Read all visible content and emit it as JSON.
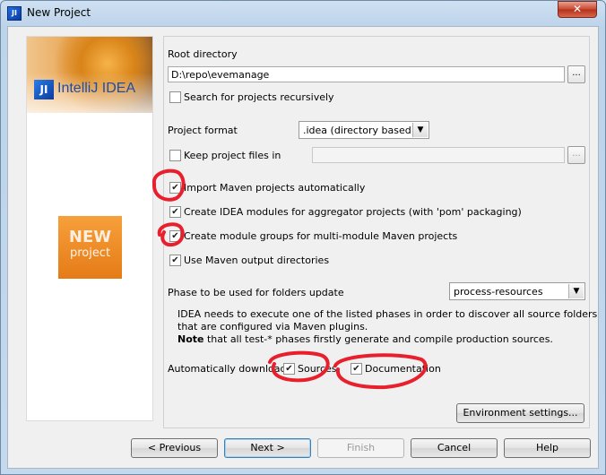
{
  "window": {
    "title": "New Project",
    "close_icon": "close-icon"
  },
  "banner": {
    "logo_text": "IntelliJ IDEA",
    "new_label": "NEW",
    "project_label": "project"
  },
  "form": {
    "root_dir_label": "Root directory",
    "root_dir_value": "D:\\repo\\evemanage",
    "browse_label": "...",
    "search_recursive_label": "Search for projects recursively",
    "search_recursive_checked": false,
    "project_format_label": "Project format",
    "project_format_value": ".idea (directory based)",
    "keep_files_label": "Keep project files in",
    "keep_files_checked": false,
    "keep_files_value": "",
    "keep_files_browse": "...",
    "import_maven_label": "Import Maven projects automatically",
    "import_maven_checked": true,
    "create_modules_label": "Create IDEA modules for aggregator projects (with 'pom' packaging)",
    "create_modules_checked": true,
    "create_groups_label": "Create module groups for multi-module Maven projects",
    "create_groups_checked": true,
    "use_output_label": "Use Maven output directories",
    "use_output_checked": true,
    "phase_label": "Phase to be used for folders update",
    "phase_value": "process-resources",
    "info_line1": "IDEA needs to execute one of the listed phases in order to discover all source folders",
    "info_line2": "that are configured via Maven plugins.",
    "info_note_bold": "Note",
    "info_note_rest": " that all test-* phases firstly generate and compile production sources.",
    "auto_download_label": "Automatically download",
    "sources_label": "Sources",
    "sources_checked": true,
    "docs_label": "Documentation",
    "docs_checked": true,
    "env_settings_label": "Environment settings..."
  },
  "buttons": {
    "previous": "< Previous",
    "next": "Next >",
    "finish": "Finish",
    "cancel": "Cancel",
    "help": "Help"
  },
  "colors": {
    "annotation_red": "#e8202e",
    "banner_orange": "#e8821f"
  }
}
